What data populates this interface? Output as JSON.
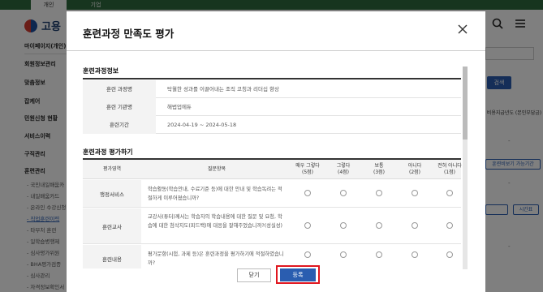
{
  "top_tabs": [
    "개인",
    "기업"
  ],
  "logo_text": "고용",
  "header_icons": [
    "search-icon",
    "menu-icon"
  ],
  "sidebar": {
    "items": [
      "마이페이지(개인)",
      "회원정보관리",
      "맞춤정보",
      "잡케어",
      "민원신청 현황",
      "서비스이력",
      "구직관리",
      "훈련관리"
    ],
    "sub_items": [
      "- 국민내일배움카",
      "- 내일배움카드",
      "- 온라인 수강신청",
      "- 직업훈련이력",
      "- 타부처 훈련",
      "- 일학습병행제",
      "- 심사평가위원",
      "- BHA평가검증",
      "- 심사관리",
      "- 자격정보확인서"
    ]
  },
  "right_panel": {
    "search_label": "검색",
    "col_header": "비용지급년도 (본인부담금)",
    "dash": "-",
    "btn_label": "훈련비보기 가능기간",
    "btn2_label": "시간표"
  },
  "modal": {
    "title": "훈련과정 만족도 평가",
    "close_icon": "close-icon",
    "course_section_title": "훈련과정정보",
    "course_info": [
      {
        "label": "훈련 과정명",
        "value": "탁월한 성과를 이끌어내는 조직 코칭과 리더십 향상"
      },
      {
        "label": "훈련 기관명",
        "value": "해법업에듀"
      },
      {
        "label": "훈련기간",
        "value": "2024-04-19 ~ 2024-05-18"
      }
    ],
    "eval_section_title": "훈련과정 평가하기",
    "eval_headers": {
      "area": "평가영역",
      "question": "질문항목",
      "options": [
        {
          "label": "매우 그렇다",
          "score": "(5점)"
        },
        {
          "label": "그렇다",
          "score": "(4점)"
        },
        {
          "label": "보통",
          "score": "(3점)"
        },
        {
          "label": "아니다",
          "score": "(2점)"
        },
        {
          "label": "전혀 아니다",
          "score": "(1점)"
        }
      ]
    },
    "eval_rows": [
      {
        "area": "행정서비스",
        "question": "학습활동(학습안내, 수료기준 등)에 대한 안내 및 학습독려는 적절하게 이루어졌습니까?"
      },
      {
        "area": "훈련교사",
        "question": "교강사(튜터)께서는 학습자의 학습내용에 대한 질문 및 요청, 학습에 대한 첨삭지도(피드백)에 대응을 잘해주었습니까?(성실성)"
      },
      {
        "area": "훈련내용",
        "question": "평가문항(시험, 과제 등)은 훈련과정을 평가하기에 적절하였습니까?"
      }
    ],
    "buttons": {
      "close": "닫기",
      "submit": "등록"
    }
  }
}
